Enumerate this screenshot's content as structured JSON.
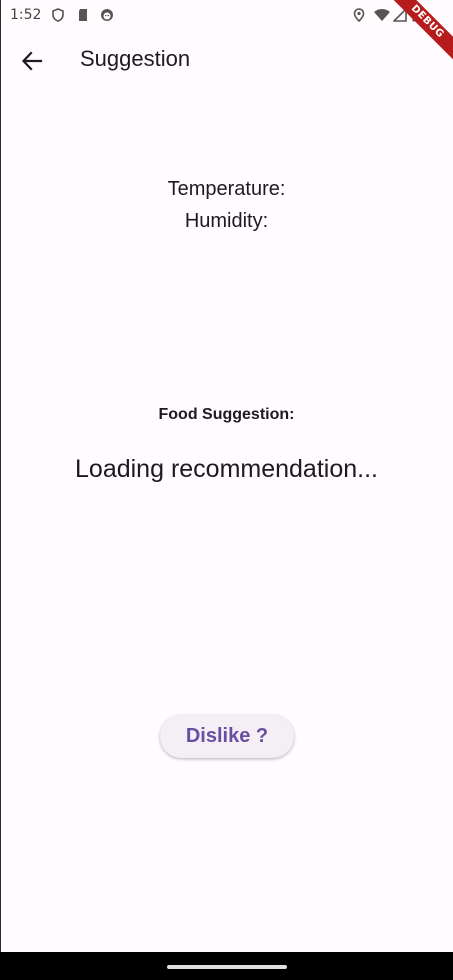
{
  "status_bar": {
    "time": "1:52",
    "left_icons": [
      "shield-icon",
      "sd-card-icon",
      "face-icon"
    ],
    "right_icons": [
      "location-icon",
      "wifi-icon",
      "signal-icon",
      "battery-icon"
    ]
  },
  "debug_banner": "DEBUG",
  "app_bar": {
    "back_icon": "arrow-back-icon",
    "title": "Suggestion"
  },
  "weather": {
    "temperature_label": "Temperature:",
    "humidity_label": "Humidity:"
  },
  "food": {
    "label": "Food Suggestion:",
    "status": "Loading recommendation..."
  },
  "actions": {
    "dislike_label": "Dislike ?"
  },
  "colors": {
    "background": "#fffbfe",
    "accent": "#6750a4",
    "button_bg": "#f4eff4",
    "debug_banner": "#b71c1c"
  }
}
